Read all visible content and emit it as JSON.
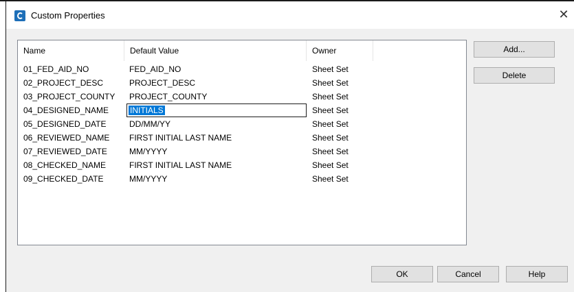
{
  "window": {
    "title": "Custom Properties",
    "close_glyph": "✕"
  },
  "table": {
    "headers": [
      "Name",
      "Default Value",
      "Owner"
    ],
    "editing_row_index": 3,
    "rows": [
      {
        "name": "01_FED_AID_NO",
        "value": "FED_AID_NO",
        "owner": "Sheet Set"
      },
      {
        "name": "02_PROJECT_DESC",
        "value": "PROJECT_DESC",
        "owner": "Sheet Set"
      },
      {
        "name": "03_PROJECT_COUNTY",
        "value": "PROJECT_COUNTY",
        "owner": "Sheet Set"
      },
      {
        "name": "04_DESIGNED_NAME",
        "value": "INITIALS",
        "owner": "Sheet Set"
      },
      {
        "name": "05_DESIGNED_DATE",
        "value": "DD/MM/YY",
        "owner": "Sheet Set"
      },
      {
        "name": "06_REVIEWED_NAME",
        "value": "FIRST INITIAL LAST NAME",
        "owner": "Sheet Set"
      },
      {
        "name": "07_REVIEWED_DATE",
        "value": "MM/YYYY",
        "owner": "Sheet Set"
      },
      {
        "name": "08_CHECKED_NAME",
        "value": "FIRST INITIAL LAST NAME",
        "owner": "Sheet Set"
      },
      {
        "name": "09_CHECKED_DATE",
        "value": "MM/YYYY",
        "owner": "Sheet Set"
      }
    ]
  },
  "buttons": {
    "add": "Add...",
    "delete": "Delete",
    "ok": "OK",
    "cancel": "Cancel",
    "help": "Help"
  },
  "colors": {
    "selection": "#0078d7",
    "app_icon": "#1e6fb8"
  }
}
